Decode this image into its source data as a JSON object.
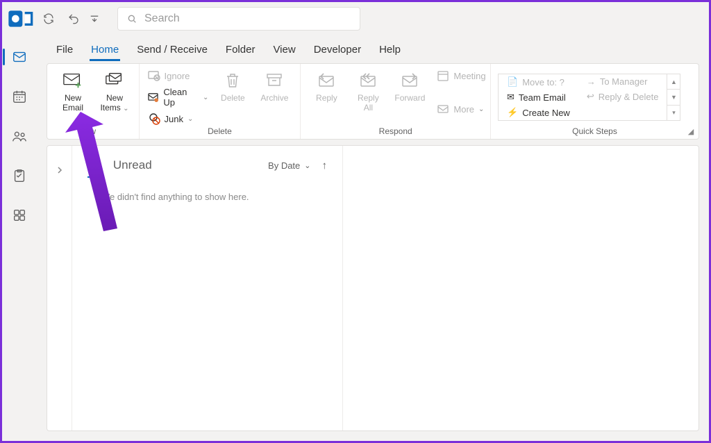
{
  "search": {
    "placeholder": "Search"
  },
  "tabs": {
    "file": "File",
    "home": "Home",
    "send_receive": "Send / Receive",
    "folder": "Folder",
    "view": "View",
    "developer": "Developer",
    "help": "Help"
  },
  "ribbon": {
    "new": {
      "new_email": "New\nEmail",
      "new_items": "New\nItems",
      "group_label": "w"
    },
    "delete": {
      "ignore": "Ignore",
      "clean_up": "Clean Up",
      "junk": "Junk",
      "delete": "Delete",
      "archive": "Archive",
      "group_label": "Delete"
    },
    "respond": {
      "reply": "Reply",
      "reply_all": "Reply\nAll",
      "forward": "Forward",
      "meeting": "Meeting",
      "more": "More",
      "group_label": "Respond"
    },
    "quick_steps": {
      "move_to": "Move to: ?",
      "team_email": "Team Email",
      "create_new": "Create New",
      "to_manager": "To Manager",
      "reply_delete": "Reply & Delete",
      "group_label": "Quick Steps"
    }
  },
  "inbox": {
    "tabs": {
      "all": "All",
      "unread": "Unread"
    },
    "sort_label": "By Date",
    "empty_message": "We didn't find anything to show here."
  }
}
